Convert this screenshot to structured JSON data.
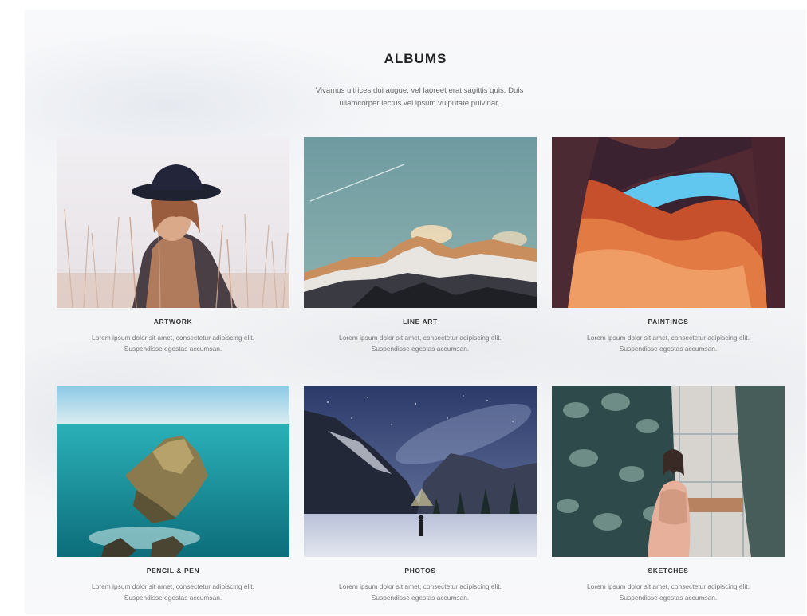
{
  "header": {
    "title": "ALBUMS",
    "subtitle": "Vivamus ultrices dui augue, vel laoreet erat sagittis quis. Duis\nullamcorper lectus vel ipsum vulputate pulvinar."
  },
  "albums": [
    {
      "label": "ARTWORK",
      "description": "Lorem ipsum dolor sit amet, consectetur adipiscing elit.\nSuspendisse egestas accumsan.",
      "image": "woman-in-hat-in-field"
    },
    {
      "label": "LINE ART",
      "description": "Lorem ipsum dolor sit amet, consectetur adipiscing elit.\nSuspendisse egestas accumsan.",
      "image": "snowy-mountain-peaks"
    },
    {
      "label": "PAINTINGS",
      "description": "Lorem ipsum dolor sit amet, consectetur adipiscing elit.\nSuspendisse egestas accumsan.",
      "image": "red-rock-canyon-arch"
    },
    {
      "label": "PENCIL & PEN",
      "description": "Lorem ipsum dolor sit amet, consectetur adipiscing elit.\nSuspendisse egestas accumsan.",
      "image": "rocky-island-in-sea"
    },
    {
      "label": "PHOTOS",
      "description": "Lorem ipsum dolor sit amet, consectetur adipiscing elit.\nSuspendisse egestas accumsan.",
      "image": "person-under-night-sky"
    },
    {
      "label": "SKETCHES",
      "description": "Lorem ipsum dolor sit amet, consectetur adipiscing elit.\nSuspendisse egestas accumsan.",
      "image": "woman-among-plants"
    }
  ]
}
